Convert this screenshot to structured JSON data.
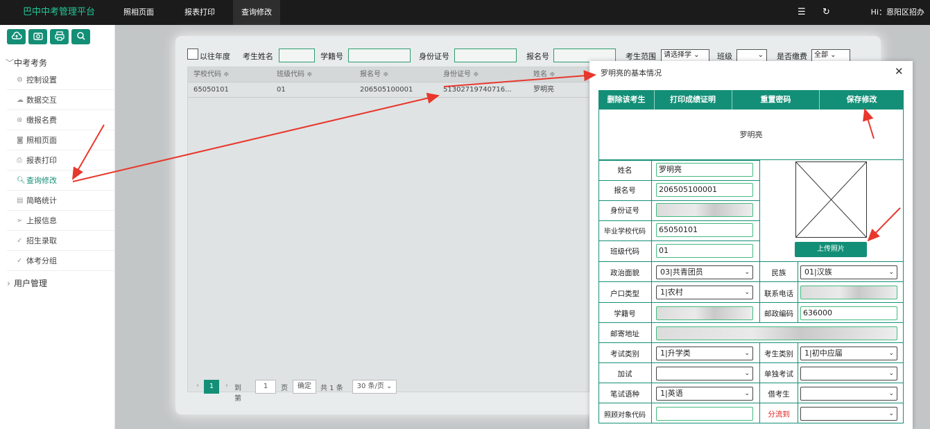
{
  "app": {
    "brand": "巴中中考管理平台",
    "nav": [
      "照相页面",
      "报表打印",
      "查询修改"
    ],
    "active_nav": "查询修改",
    "user": "Hi：恩阳区招办"
  },
  "sidebar": {
    "groups": [
      {
        "label": "中考考务",
        "expanded": true
      },
      {
        "label": "用户管理",
        "expanded": false
      }
    ],
    "items": [
      {
        "label": "控制设置",
        "icon": "gear-icon"
      },
      {
        "label": "数据交互",
        "icon": "cloud-icon"
      },
      {
        "label": "缴报名费",
        "icon": "yen-icon"
      },
      {
        "label": "照相页面",
        "icon": "camera-icon"
      },
      {
        "label": "报表打印",
        "icon": "printer-icon"
      },
      {
        "label": "查询修改",
        "icon": "search-icon",
        "active": true
      },
      {
        "label": "简略统计",
        "icon": "chart-icon"
      },
      {
        "label": "上报信息",
        "icon": "send-icon"
      },
      {
        "label": "招生录取",
        "icon": "check-icon"
      },
      {
        "label": "体考分组",
        "icon": "check-icon"
      }
    ]
  },
  "filter": {
    "history": "以往年度",
    "name": "考生姓名",
    "xjh": "学籍号",
    "sfz": "身份证号",
    "bmh": "报名号",
    "scope": "考生范围",
    "scope_sel": "请选择学",
    "class": "班级",
    "paid": "是否缴费",
    "paid_sel": "全部"
  },
  "grid": {
    "columns": [
      "学校代码 ≑",
      "班级代码 ≑",
      "报名号 ≑",
      "身份证号 ≑",
      "姓名 ≑"
    ],
    "rows": [
      [
        "65050101",
        "01",
        "206505100001",
        "51302719740716...",
        "罗明亮"
      ]
    ]
  },
  "pager": {
    "current": "1",
    "goto": "到第",
    "page_val": "1",
    "page": "页",
    "confirm": "确定",
    "total": "共 1 条",
    "per": "30 条/页"
  },
  "modal": {
    "title": "罗明亮的基本情况",
    "buttons": [
      "删除该考生",
      "打印成绩证明",
      "重置密码",
      "保存修改"
    ],
    "display_name": "罗明亮",
    "upload": "上传照片",
    "labels": {
      "name": "姓名",
      "bmh": "报名号",
      "sfz": "身份证号",
      "school": "毕业学校代码",
      "class": "班级代码",
      "political": "政治面貌",
      "nation": "民族",
      "hukou": "户口类型",
      "phone": "联系电话",
      "xjh": "学籍号",
      "post": "邮政编码",
      "address": "邮寄地址",
      "examtype": "考试类别",
      "stutype": "考生类别",
      "extra": "加试",
      "single": "单独考试",
      "lang": "笔试语种",
      "borrow": "借考生",
      "care": "照顾对象代码",
      "flow": "分流到"
    },
    "values": {
      "name": "罗明亮",
      "bmh": "206505100001",
      "school": "65050101",
      "class": "01",
      "political": "03|共青团员",
      "nation": "01|汉族",
      "hukou": "1|农村",
      "post": "636000",
      "examtype": "1|升学类",
      "stutype": "1|初中应届",
      "lang": "1|英语"
    }
  }
}
